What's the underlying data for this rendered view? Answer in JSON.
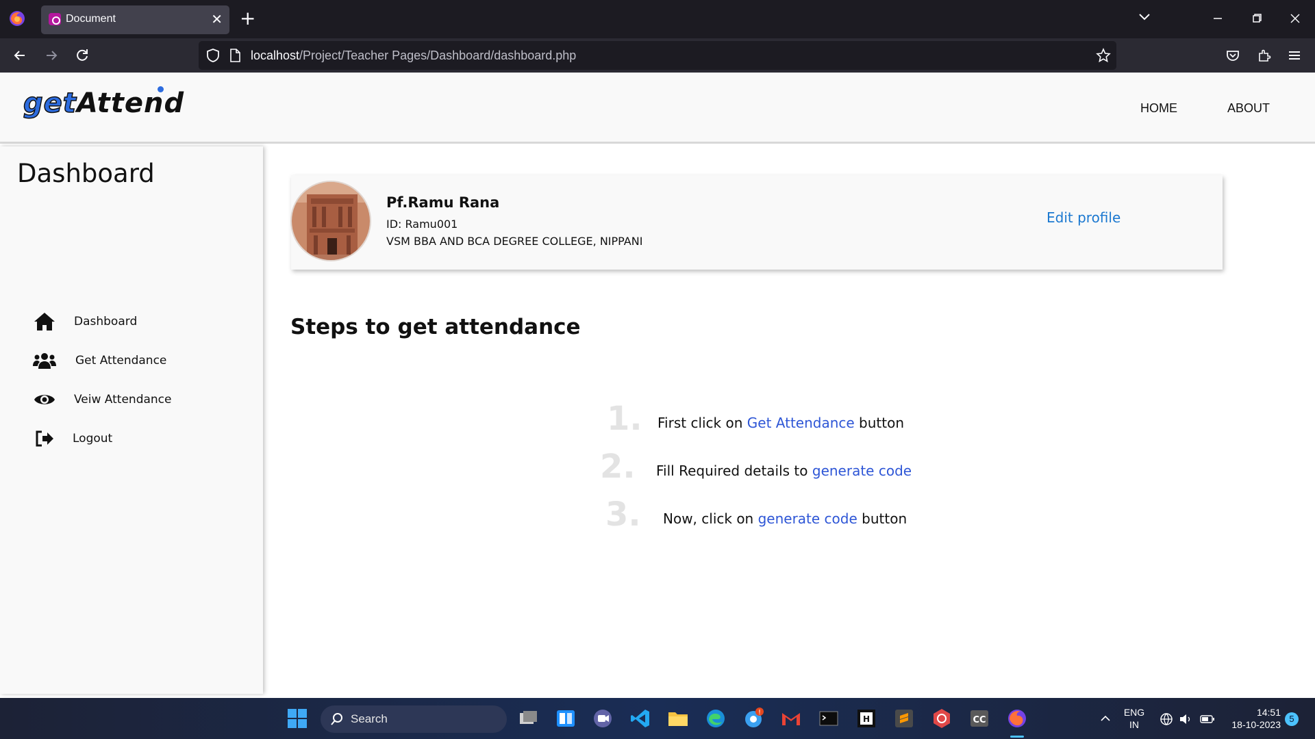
{
  "browser": {
    "tab_title": "Document",
    "tab_close": "✕",
    "new_tab": "+",
    "url_host": "localhost",
    "url_path": "/Project/Teacher Pages/Dashboard/dashboard.php"
  },
  "site": {
    "logo_get": "get",
    "logo_attend": "Attend",
    "nav": [
      "HOME",
      "ABOUT"
    ]
  },
  "sidebar": {
    "title": "Dashboard",
    "items": [
      {
        "label": "Dashboard",
        "icon": "home-icon"
      },
      {
        "label": "Get Attendance",
        "icon": "users-icon"
      },
      {
        "label": "Veiw Attendance",
        "icon": "eye-icon"
      },
      {
        "label": "Logout",
        "icon": "logout-icon"
      }
    ]
  },
  "profile": {
    "name": "Pf.Ramu Rana",
    "id": "ID: Ramu001",
    "college": "VSM BBA AND BCA DEGREE COLLEGE, NIPPANI",
    "edit_label": "Edit profile"
  },
  "steps": {
    "heading": "Steps to get attendance",
    "items": [
      {
        "num": "1.",
        "before": "First click on ",
        "highlight": "Get Attendance",
        "after": " button"
      },
      {
        "num": "2.",
        "before": "Fill Required details to ",
        "highlight": "generate code",
        "after": ""
      },
      {
        "num": "3.",
        "before": "Now, click on ",
        "highlight": "generate code",
        "after": " button"
      }
    ]
  },
  "taskbar": {
    "search_label": "Search",
    "lang_line1": "ENG",
    "lang_line2": "IN",
    "time": "14:51",
    "date": "18-10-2023",
    "notification_count": "5"
  },
  "colors": {
    "accent_link": "#1b78d0",
    "step_highlight": "#2e56d6",
    "logo_blue": "#2d6cdf"
  }
}
